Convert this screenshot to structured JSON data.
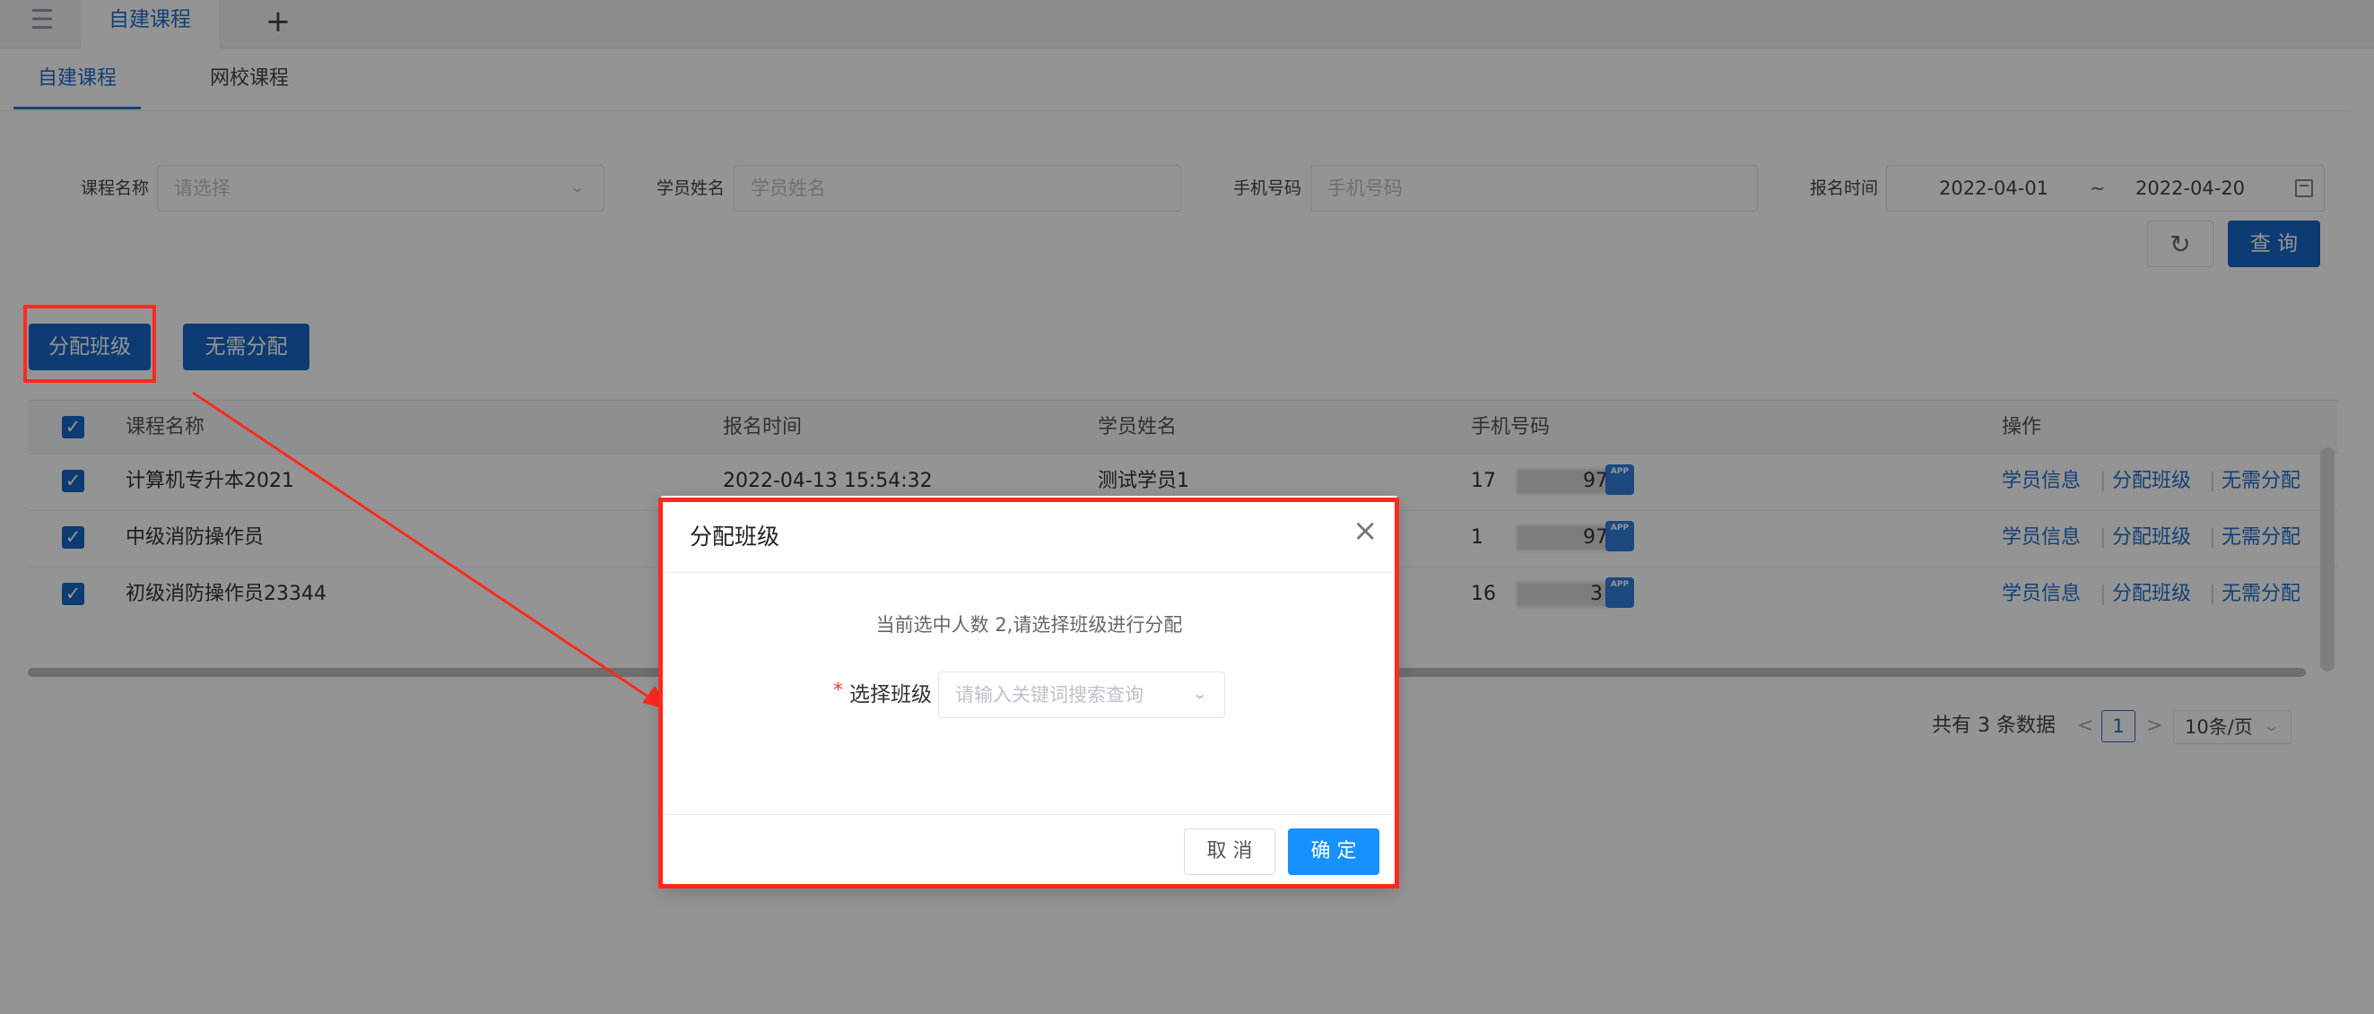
{
  "topbar": {
    "menu_icon": "menu-collapse-icon",
    "tab_label": "自建课程",
    "add_symbol": "+"
  },
  "subtabs": [
    "自建课程",
    "网校课程"
  ],
  "filters": {
    "course_label": "课程名称",
    "course_placeholder": "请选择",
    "student_label": "学员姓名",
    "student_placeholder": "学员姓名",
    "phone_label": "手机号码",
    "phone_placeholder": "手机号码",
    "date_label": "报名时间",
    "date_start": "2022-04-01",
    "date_separator": "~",
    "date_end": "2022-04-20",
    "reset_icon": "refresh-icon",
    "query_label": "查 询"
  },
  "actions": {
    "assign_class": "分配班级",
    "no_assign": "无需分配"
  },
  "table": {
    "headers": [
      "课程名称",
      "报名时间",
      "学员姓名",
      "手机号码",
      "操作"
    ],
    "rows": [
      {
        "course": "计算机专升本2021",
        "time": "2022-04-13 15:54:32",
        "student": "测试学员1",
        "phone_start": "17",
        "phone_end": "97",
        "ops": [
          "学员信息",
          "分配班级",
          "无需分配"
        ]
      },
      {
        "course": "中级消防操作员",
        "time": "",
        "student": "",
        "phone_start": "1",
        "phone_end": "97",
        "ops": [
          "学员信息",
          "分配班级",
          "无需分配"
        ]
      },
      {
        "course": "初级消防操作员23344",
        "time": "",
        "student": "",
        "phone_start": "16",
        "phone_end": "3",
        "ops": [
          "学员信息",
          "分配班级",
          "无需分配"
        ]
      }
    ],
    "app_icon_text": "APP",
    "op_separator": "|"
  },
  "pagination": {
    "total": "共有 3 条数据",
    "prev": "<",
    "page": "1",
    "next": ">",
    "page_size": "10条/页"
  },
  "dialog": {
    "title": "分配班级",
    "message": "当前选中人数 2,请选择班级进行分配",
    "required_mark": "*",
    "label": "选择班级",
    "placeholder": "请输入关键词搜索查询",
    "cancel": "取 消",
    "confirm": "确 定",
    "close_symbol": "×"
  },
  "colors": {
    "primary": "#1766c7",
    "highlight_red": "#ff2a1f",
    "dialog_primary": "#1890ff"
  }
}
